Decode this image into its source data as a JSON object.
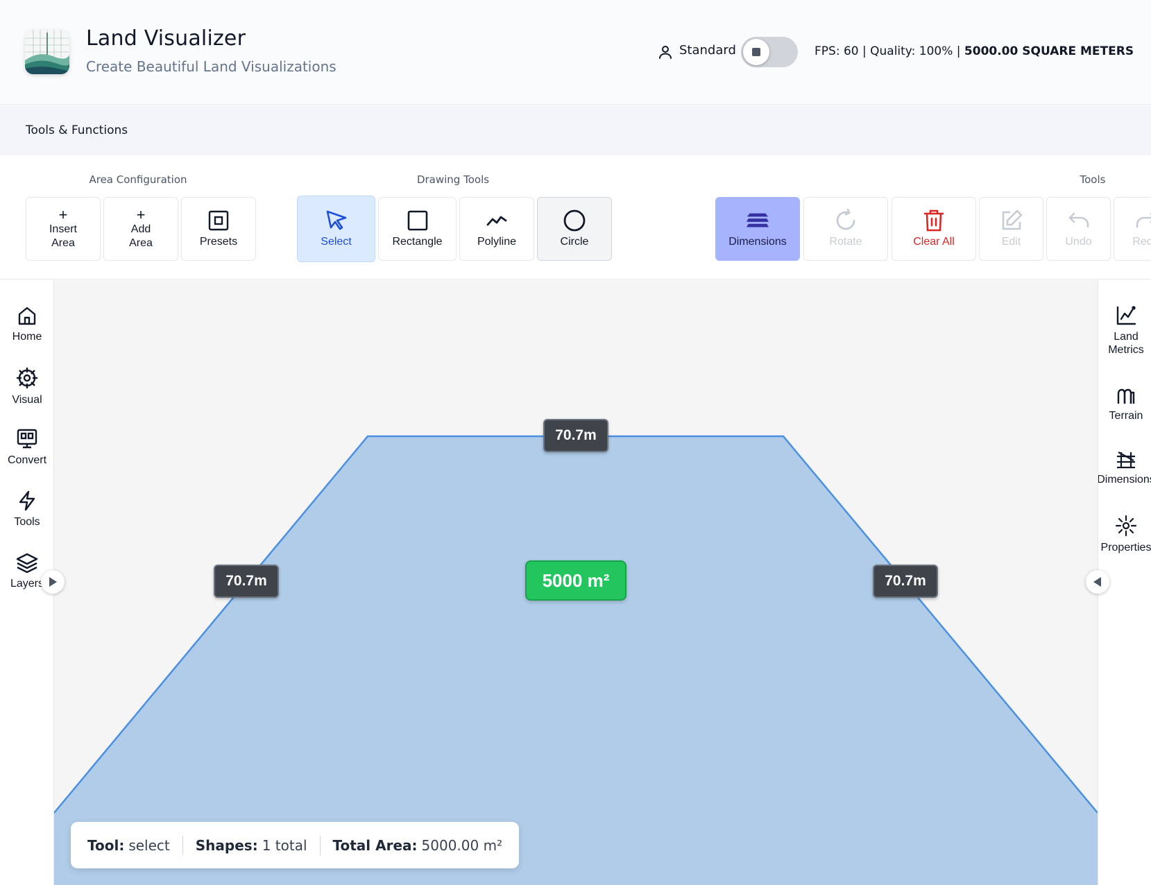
{
  "header": {
    "title": "Land Visualizer",
    "subtitle": "Create Beautiful Land Visualizations",
    "mode_label": "Standard",
    "status_prefix": "FPS: 60 | Quality: 100% | ",
    "status_area": "5000.00 SQUARE METERS"
  },
  "section": {
    "title": "Tools & Functions"
  },
  "toolbar": {
    "groups": {
      "area_configuration": "Area Configuration",
      "drawing_tools": "Drawing Tools",
      "tools": "Tools"
    },
    "insert_area": {
      "line1": "Insert",
      "line2": "Area"
    },
    "add_area": {
      "line1": "Add",
      "line2": "Area"
    },
    "plus_glyph": "+",
    "presets": "Presets",
    "select": "Select",
    "rectangle": "Rectangle",
    "polyline": "Polyline",
    "circle": "Circle",
    "dimensions": "Dimensions",
    "rotate": "Rotate",
    "clear_all": "Clear All",
    "edit": "Edit",
    "undo": "Undo",
    "redo": "Redo"
  },
  "left_rail": [
    "Home",
    "Visual",
    "Convert",
    "Tools",
    "Layers"
  ],
  "right_rail": {
    "land_metrics": {
      "line1": "Land",
      "line2": "Metrics"
    },
    "terrain": "Terrain",
    "dimensions": "Dimensions",
    "properties": "Properties"
  },
  "canvas": {
    "shape_fill": "#b0cce8",
    "shape_stroke": "#4a90e2",
    "top_edge_label": "70.7m",
    "left_edge_label": "70.7m",
    "right_edge_label": "70.7m",
    "area_label": "5000 m²"
  },
  "status_bar": {
    "tool_key": "Tool:",
    "tool_value": "select",
    "shapes_key": "Shapes:",
    "shapes_value": "1 total",
    "area_key": "Total Area:",
    "area_value": "5000.00 m²"
  },
  "colors": {
    "accent_select": "#1d4ed8",
    "accent_dimensions": "#a5b4fc",
    "danger": "#dc2626",
    "area_badge": "#22c55e"
  },
  "icons": {
    "left_rail": [
      "home-icon",
      "visual-icon",
      "convert-icon",
      "tools-icon",
      "layers-icon"
    ],
    "right_rail": [
      "chart-icon",
      "terrain-icon",
      "dimensions-icon",
      "properties-icon"
    ]
  }
}
